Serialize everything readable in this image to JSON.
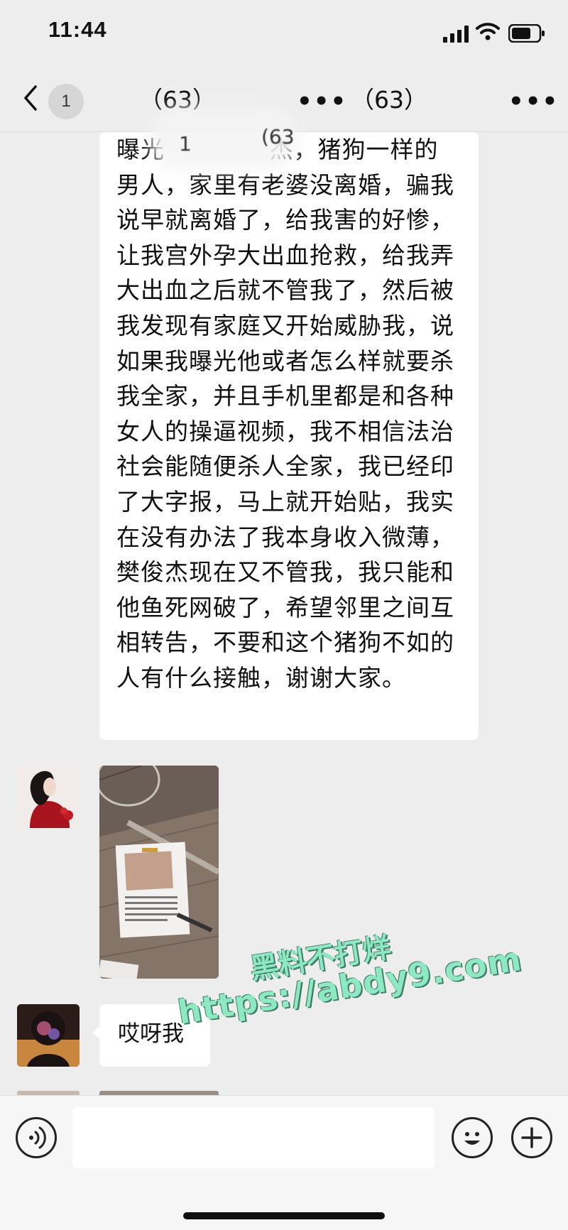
{
  "status_bar": {
    "time": "11:44"
  },
  "nav": {
    "unread_count": "1",
    "title_left": "（63）",
    "title_dots": "•••",
    "title_right": "（63）",
    "more_label": "•••"
  },
  "ghost_header": {
    "badge": "1",
    "count": "(63"
  },
  "messages": [
    {
      "type": "text",
      "text": "曝光 　　　　杰，猪狗一样的男人，家里有老婆没离婚，骗我说早就离婚了，给我害的好惨，让我宫外孕大出血抢救，给我弄大出血之后就不管我了，然后被我发现有家庭又开始威胁我，说如果我曝光他或者怎么样就要杀我全家，并且手机里都是和各种女人的操逼视频，我不相信法治社会能随便杀人全家，我已经印了大字报，马上就开始贴，我实在没有办法了我本身收入微薄，樊俊杰现在又不管我，我只能和他鱼死网破了，希望邻里之间互相转告，不要和这个猪狗不如的人有什么接触，谢谢大家。"
    },
    {
      "type": "image",
      "description_icon": "photo-icon"
    },
    {
      "type": "text",
      "text": "哎呀我"
    }
  ],
  "watermark": {
    "line1": "黑料不打烊",
    "line2": "https://abdy9.com"
  },
  "colors": {
    "background": "#ededed",
    "bubble": "#ffffff",
    "watermark": "#8ee8c2"
  }
}
